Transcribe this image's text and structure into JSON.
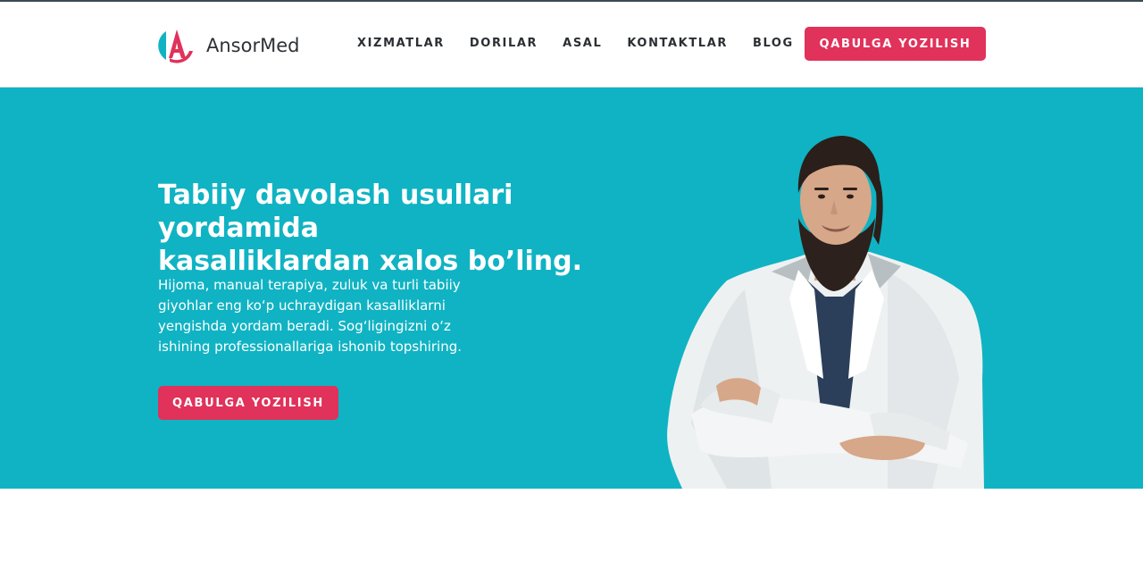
{
  "brand": {
    "name": "AnsorMed",
    "logo_icon": "ansormed-logo-icon",
    "colors": {
      "teal": "#10b3c3",
      "accent": "#e0325a"
    }
  },
  "nav": {
    "items": [
      {
        "label": "XIZMATLAR"
      },
      {
        "label": "DORILAR"
      },
      {
        "label": "ASAL"
      },
      {
        "label": "KONTAKTLAR"
      },
      {
        "label": "BLOG"
      }
    ],
    "cta_label": "QABULGA YOZILISH"
  },
  "hero": {
    "title_line1": "Tabiiy davolash usullari yordamida",
    "title_line2": "kasalliklardan xalos bo’ling.",
    "text": "Hijoma, manual terapiya, zuluk va turli tabiiy giyohlar eng ko‘p uchraydigan kasalliklarni yengishda yordam beradi. Sog‘ligingizni o‘z ishining professionallariga ishonib topshiring.",
    "cta_label": "QABULGA YOZILISH",
    "image": "doctor-photo"
  }
}
